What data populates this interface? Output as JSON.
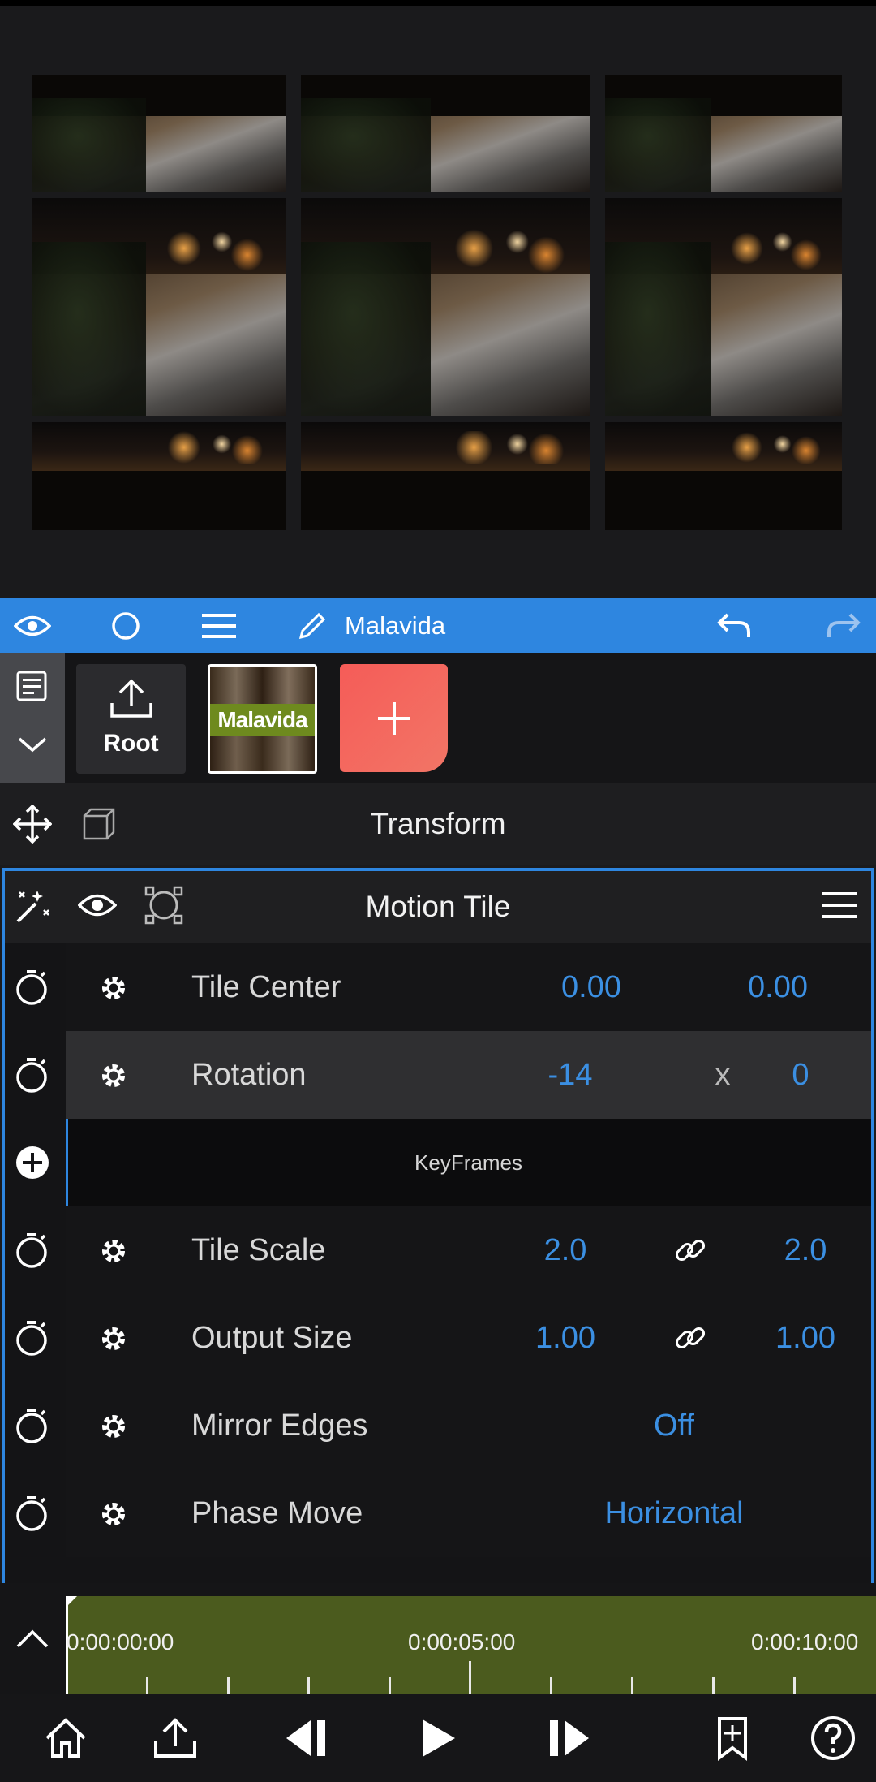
{
  "preview": {
    "image_description_icon": "night-city-traffic-tile-grid"
  },
  "toolbar": {
    "title": "Malavida",
    "icons": [
      "eye-icon",
      "circle-icon",
      "menu-icon",
      "pencil-icon",
      "undo-icon",
      "redo-icon"
    ],
    "accent": "#2e86e0"
  },
  "layers": {
    "root_label": "Root",
    "clip_label": "Malavida",
    "add_label": "+"
  },
  "transform": {
    "title": "Transform"
  },
  "effect": {
    "title": "Motion Tile",
    "params": [
      {
        "label": "Tile Center",
        "v1": "0.00",
        "mid": "",
        "v2": "0.00"
      },
      {
        "label": "Rotation",
        "v1": "-14",
        "mid": "x",
        "v2": "0"
      },
      {
        "label": "Tile Scale",
        "v1": "2.0",
        "mid": "link",
        "v2": "2.0"
      },
      {
        "label": "Output Size",
        "v1": "1.00",
        "mid": "link",
        "v2": "1.00"
      },
      {
        "label": "Mirror Edges",
        "value": "Off"
      },
      {
        "label": "Phase Move",
        "value": "Horizontal"
      }
    ],
    "keyframes_label": "KeyFrames",
    "value_color": "#3b8fe2"
  },
  "timeline": {
    "timecodes": [
      "0:00:00:00",
      "0:00:05:00",
      "0:00:10:00"
    ],
    "strip_color": "#4b5b1e"
  },
  "bottom_bar": {
    "icons": [
      "home-icon",
      "share-icon",
      "step-back-icon",
      "play-icon",
      "step-forward-icon",
      "bookmark-icon",
      "help-icon"
    ]
  }
}
